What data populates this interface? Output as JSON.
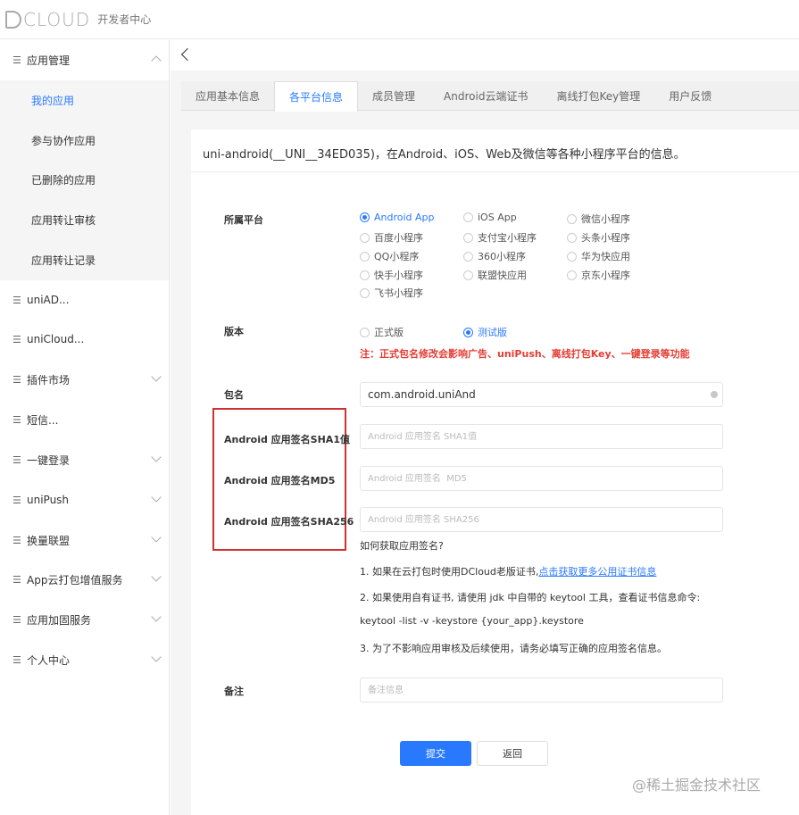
{
  "header": {
    "brand": "DCLOUD",
    "brand_initial": "D",
    "brand_rest": "CLOUD",
    "subtitle": "开发者中心"
  },
  "sidebar": {
    "top_items": [
      {
        "label": "应用管理",
        "expanded": true
      },
      {
        "label": "uniAD..."
      },
      {
        "label": "uniCloud..."
      },
      {
        "label": "插件市场"
      },
      {
        "label": "短信..."
      },
      {
        "label": "一键登录"
      },
      {
        "label": "uniPush"
      },
      {
        "label": "换量联盟"
      },
      {
        "label": "App云打包增值服务"
      },
      {
        "label": "应用加固服务"
      },
      {
        "label": "个人中心"
      }
    ],
    "sub_items": [
      {
        "label": "我的应用",
        "active": true
      },
      {
        "label": "参与协作应用"
      },
      {
        "label": "已删除的应用"
      },
      {
        "label": "应用转让审核"
      },
      {
        "label": "应用转让记录"
      }
    ]
  },
  "tabs": [
    {
      "label": "应用基本信息"
    },
    {
      "label": "各平台信息",
      "active": true
    },
    {
      "label": "成员管理"
    },
    {
      "label": "Android云端证书"
    },
    {
      "label": "离线打包Key管理"
    },
    {
      "label": "用户反馈"
    }
  ],
  "form": {
    "title": "uni-android(__UNI__34ED035)，在Android、iOS、Web及微信等各种小程序平台的信息。",
    "platform_label": "所属平台",
    "platforms": [
      {
        "label": "Android App",
        "checked": true
      },
      {
        "label": "iOS App"
      },
      {
        "label": "微信小程序"
      },
      {
        "label": "百度小程序"
      },
      {
        "label": "支付宝小程序"
      },
      {
        "label": "头条小程序"
      },
      {
        "label": "QQ小程序"
      },
      {
        "label": "360小程序"
      },
      {
        "label": "华为快应用"
      },
      {
        "label": "快手小程序"
      },
      {
        "label": "联盟快应用"
      },
      {
        "label": "京东小程序"
      },
      {
        "label": "飞书小程序"
      }
    ],
    "version_label": "版本",
    "versions": [
      {
        "label": "正式版"
      },
      {
        "label": "测试版",
        "checked": true
      }
    ],
    "version_warning": "注：正式包名修改会影响广告、uniPush、离线打包Key、一键登录等功能",
    "package_label": "包名",
    "package_value": "com.android.uniAnd",
    "sha1_label": "Android 应用签名SHA1值",
    "sha1_placeholder": "Android 应用签名 SHA1值",
    "md5_label": "Android 应用签名MD5",
    "md5_placeholder": "Android 应用签名  MD5",
    "sha256_label": "Android 应用签名SHA256",
    "sha256_placeholder": "Android 应用签名 SHA256",
    "help_title": "如何获取应用签名?",
    "help_1_prefix": "1. 如果在云打包时使用DCloud老版证书,",
    "help_1_link": "点击获取更多公用证书信息",
    "help_2": "2. 如果使用自有证书, 请使用 jdk 中自带的 keytool 工具，查看证书信息命令:",
    "help_cmd": "keytool -list -v -keystore {your_app}.keystore",
    "help_3": "3. 为了不影响应用审核及后续使用，请务必填写正确的应用签名信息。",
    "remark_label": "备注",
    "remark_placeholder": "备注信息",
    "submit_label": "提交",
    "back_label": "返回"
  },
  "watermark": "@稀土掘金技术社区"
}
